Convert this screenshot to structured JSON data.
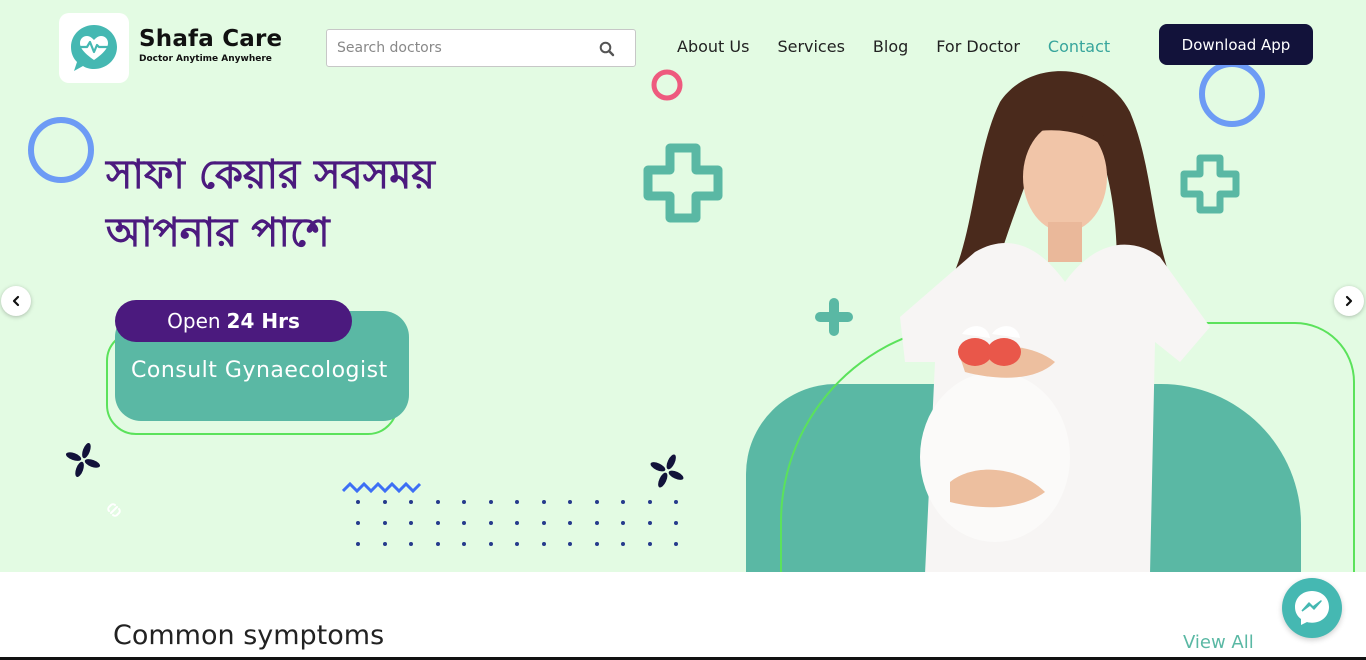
{
  "header": {
    "logo_name": "Shafa Care",
    "logo_tagline": "Doctor Anytime Anywhere",
    "search_placeholder": "Search doctors",
    "nav": [
      {
        "label": "About Us"
      },
      {
        "label": "Services"
      },
      {
        "label": "Blog"
      },
      {
        "label": "For Doctor"
      },
      {
        "label": "Contact"
      }
    ],
    "active_nav": "Contact",
    "download_label": "Download App"
  },
  "hero": {
    "headline_line1": "সাফা কেয়ার সবসময়",
    "headline_line2": "আপনার পাশে",
    "open_prefix": "Open",
    "open_hours": "24 Hrs",
    "cta_label": "Consult Gynaecologist"
  },
  "symptoms": {
    "title": "Common symptoms",
    "view_all_label": "View All"
  },
  "icons": {
    "logo": "heart-pulse-chat-icon",
    "search": "search-icon",
    "prev": "chevron-left-icon",
    "next": "chevron-right-icon",
    "messenger": "messenger-icon"
  },
  "colors": {
    "hero_bg": "#e3fbe3",
    "brand_teal": "#5ab8a4",
    "brand_purple": "#4b1a7e",
    "button_dark": "#12123a",
    "active_link": "#37a59c"
  }
}
